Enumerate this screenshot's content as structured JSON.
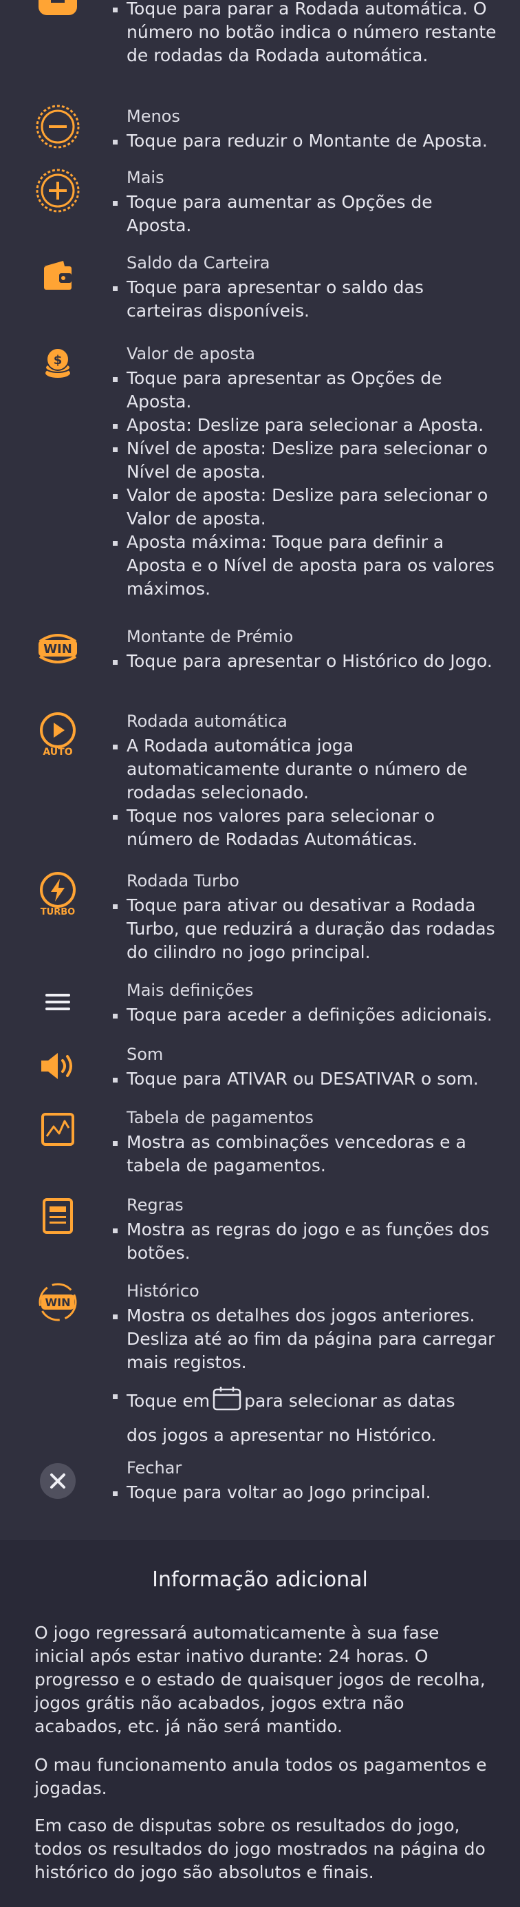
{
  "colors": {
    "background": "#30303e",
    "section_bg": "#292937",
    "accent": "#ffa434",
    "text": "#e3e3ea"
  },
  "items": [
    {
      "icon": "stop-autospin-icon",
      "title": "",
      "bullets": [
        "Toque para parar a Rodada automática. O número no botão indica o número restante de rodadas da Rodada automática."
      ]
    },
    {
      "icon": "minus-icon",
      "title": "Menos",
      "bullets": [
        "Toque para reduzir o Montante de Aposta."
      ]
    },
    {
      "icon": "plus-icon",
      "title": "Mais",
      "bullets": [
        "Toque para aumentar as Opções de Aposta."
      ]
    },
    {
      "icon": "wallet-icon",
      "title": "Saldo da Carteira",
      "bullets": [
        "Toque para apresentar o saldo das carteiras disponíveis."
      ]
    },
    {
      "icon": "coins-icon",
      "title": "Valor de aposta",
      "bullets": [
        "Toque para apresentar as Opções de Aposta.",
        "Aposta: Deslize para selecionar a Aposta.",
        "Nível de aposta: Deslize para selecionar o Nível de aposta.",
        "Valor de aposta: Deslize para selecionar o Valor de aposta.",
        "Aposta máxima: Toque para definir a Aposta e o Nível de aposta para os valores máximos."
      ]
    },
    {
      "icon": "win-icon",
      "title": "Montante de Prémio",
      "bullets": [
        "Toque para apresentar o Histórico do Jogo."
      ]
    },
    {
      "icon": "auto-spin-icon",
      "icon_label": "AUTO",
      "title": "Rodada automática",
      "bullets": [
        "A Rodada automática joga automaticamente durante o número de rodadas selecionado.",
        "Toque nos valores para selecionar o número de Rodadas Automáticas."
      ]
    },
    {
      "icon": "turbo-icon",
      "icon_label": "TURBO",
      "title": "Rodada Turbo",
      "bullets": [
        "Toque para ativar ou desativar a Rodada Turbo, que reduzirá a duração das rodadas do cilindro no jogo principal."
      ]
    },
    {
      "icon": "menu-icon",
      "title": "Mais definições",
      "bullets": [
        "Toque para aceder a definições adicionais."
      ]
    },
    {
      "icon": "speaker-icon",
      "title": "Som",
      "bullets": [
        "Toque para ATIVAR ou DESATIVAR o som."
      ]
    },
    {
      "icon": "paytable-icon",
      "title": "Tabela de pagamentos",
      "bullets": [
        "Mostra as combinações vencedoras e a tabela de pagamentos."
      ]
    },
    {
      "icon": "rules-icon",
      "title": "Regras",
      "bullets": [
        "Mostra as regras do jogo e as funções dos botões."
      ]
    },
    {
      "icon": "history-icon",
      "title": "Histórico",
      "bullets": [
        "Mostra os detalhes dos jogos anteriores. Desliza até ao fim da página para carregar mais registos."
      ],
      "calendar_before": "Toque em",
      "calendar_after": "para selecionar as datas",
      "calendar_line2": "dos jogos a apresentar no Histórico."
    },
    {
      "icon": "close-icon",
      "title": "Fechar",
      "bullets": [
        "Toque para voltar ao Jogo principal."
      ]
    }
  ],
  "win_label": "WIN",
  "additional": {
    "title": "Informação adicional",
    "paragraphs": [
      "O jogo regressará automaticamente à sua fase inicial após estar inativo durante: 24 horas. O progresso e o estado de quaisquer jogos de recolha, jogos grátis não acabados, jogos extra não acabados, etc. já não será mantido.",
      "O mau funcionamento anula todos os pagamentos e jogadas.",
      "Em caso de disputas sobre os resultados do jogo, todos os resultados do jogo mostrados na página do histórico do jogo são absolutos e finais."
    ]
  }
}
